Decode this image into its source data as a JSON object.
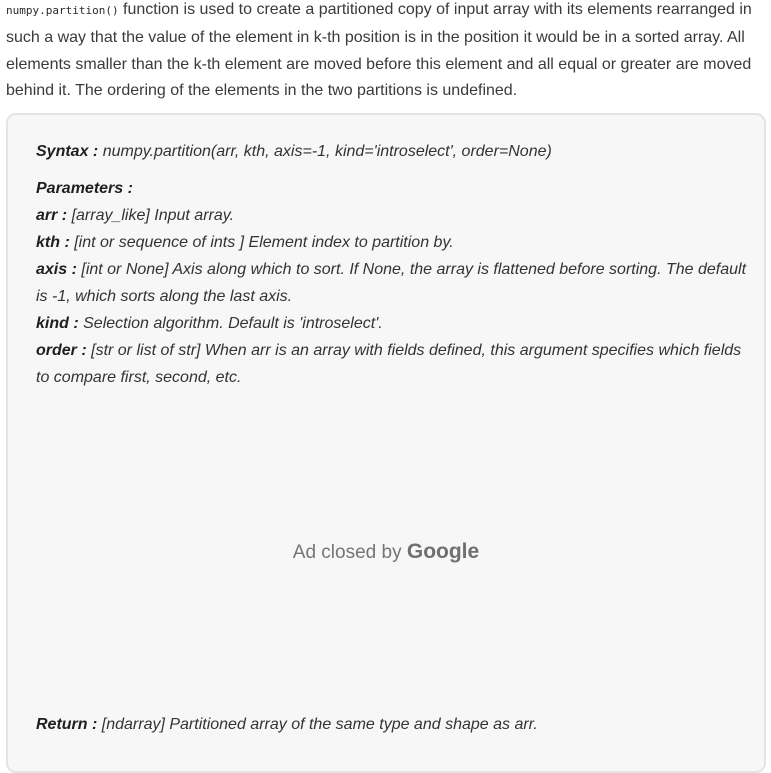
{
  "intro": {
    "code": "numpy.partition()",
    "text": " function is used to create a partitioned copy of input array with its elements rearranged in such a way that the value of the element in k-th position is in the position it would be in a sorted array. All elements smaller than the k-th element are moved before this element and all equal or greater are moved behind it. The ordering of the elements in the two partitions is undefined."
  },
  "syntax": {
    "label": "Syntax :",
    "value": " numpy.partition(arr, kth, axis=-1, kind='introselect', order=None)"
  },
  "parameters": {
    "heading": "Parameters :",
    "items": [
      {
        "name": "arr :",
        "desc": " [array_like] Input array."
      },
      {
        "name": "kth :",
        "desc": " [int or sequence of ints ] Element index to partition by."
      },
      {
        "name": "axis :",
        "desc": " [int or None] Axis along which to sort. If None, the array is flattened before sorting. The default is -1, which sorts along the last axis."
      },
      {
        "name": "kind :",
        "desc": " Selection algorithm. Default is 'introselect'."
      },
      {
        "name": "order :",
        "desc": " [str or list of str] When arr is an array with fields defined, this argument specifies which fields to compare first, second, etc."
      }
    ]
  },
  "ad": {
    "text": "Ad closed by ",
    "brand": "Google"
  },
  "return": {
    "label": "Return :",
    "value": " [ndarray] Partitioned array of the same type and shape as arr."
  }
}
